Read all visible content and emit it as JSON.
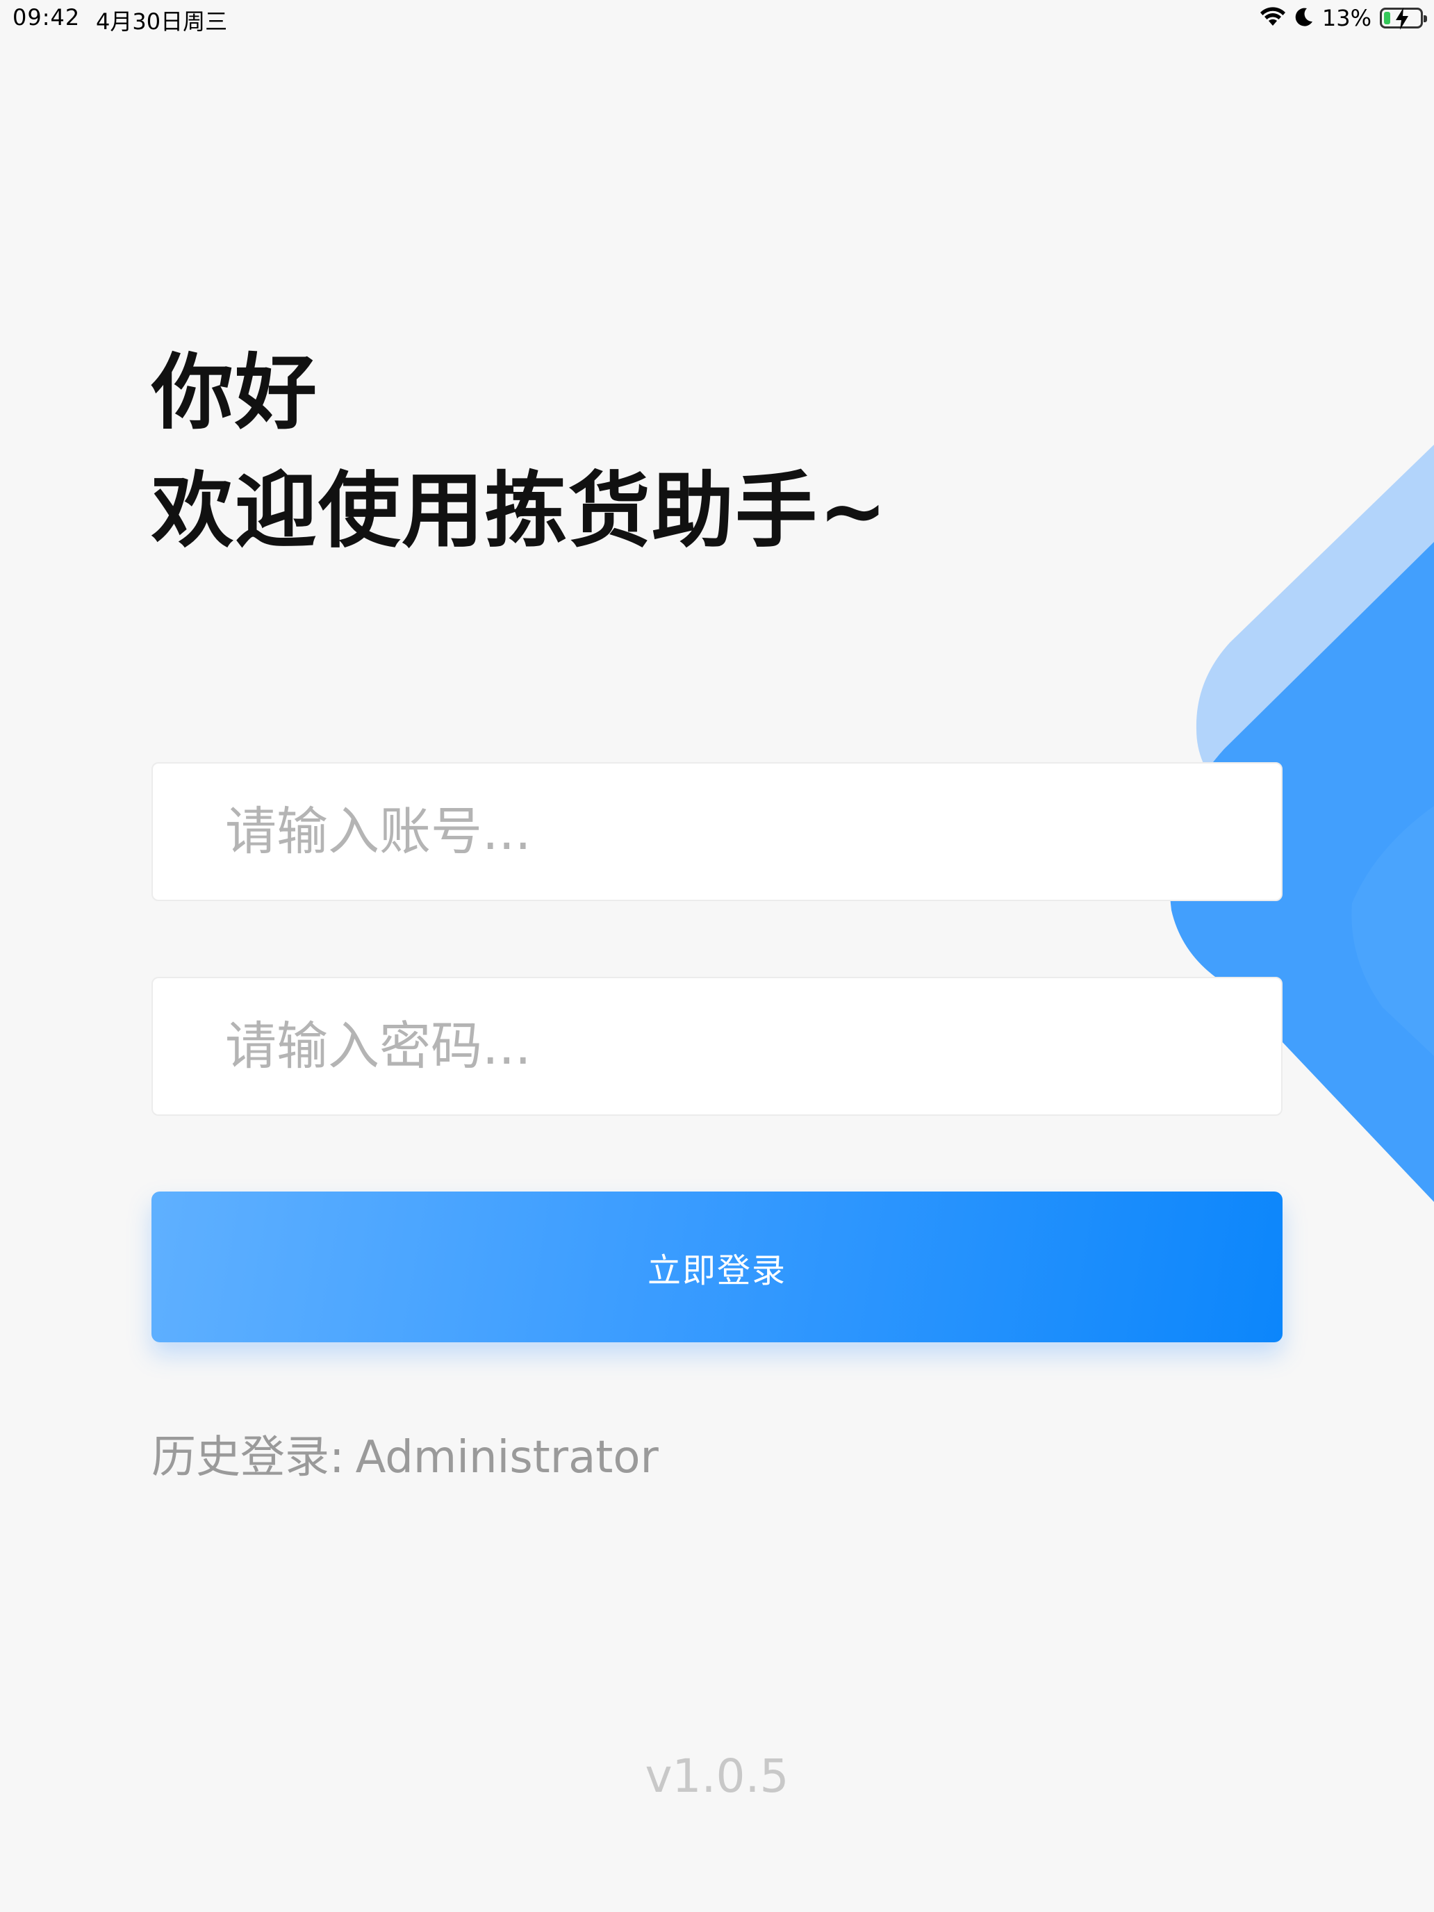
{
  "status_bar": {
    "time": "09:42",
    "date": "4月30日周三",
    "battery_percent": "13%",
    "icons": [
      "wifi-icon",
      "moon-icon",
      "battery-charging-icon"
    ]
  },
  "greeting": {
    "line1": "你好",
    "line2": "欢迎使用拣货助手~"
  },
  "form": {
    "account_placeholder": "请输入账号...",
    "password_placeholder": "请输入密码...",
    "login_label": "立即登录"
  },
  "history": {
    "label": "历史登录:",
    "user": "Administrator"
  },
  "version": "v1.0.5",
  "colors": {
    "background": "#f7f7f7",
    "accent_blue": "#0c86fb",
    "accent_blue_light": "#5fb0ff",
    "decor_light": "#b2d4fb",
    "decor_mid": "#429ffd",
    "placeholder": "#b4b4b4",
    "history_text": "#9a9a9a",
    "version_text": "#c8c8c8"
  }
}
